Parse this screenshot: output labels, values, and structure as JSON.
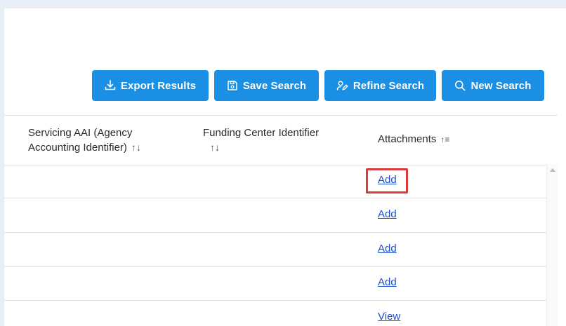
{
  "toolbar": {
    "export_label": "Export Results",
    "save_label": "Save Search",
    "refine_label": "Refine Search",
    "new_label": "New Search"
  },
  "table": {
    "headers": {
      "aai": "Servicing AAI (Agency Accounting Identifier)",
      "funding": "Funding Center Identifier",
      "attachments": "Attachments"
    },
    "sort_icons": {
      "aai": "↑↓",
      "funding": "↑↓",
      "attachments": "↑≡"
    },
    "rows": [
      {
        "attachment_link": "Add"
      },
      {
        "attachment_link": "Add"
      },
      {
        "attachment_link": "Add"
      },
      {
        "attachment_link": "Add"
      },
      {
        "attachment_link": "View"
      }
    ]
  },
  "colors": {
    "button_bg": "#1a8fe3",
    "link": "#1a4fd6",
    "highlight": "#d83b3b"
  }
}
